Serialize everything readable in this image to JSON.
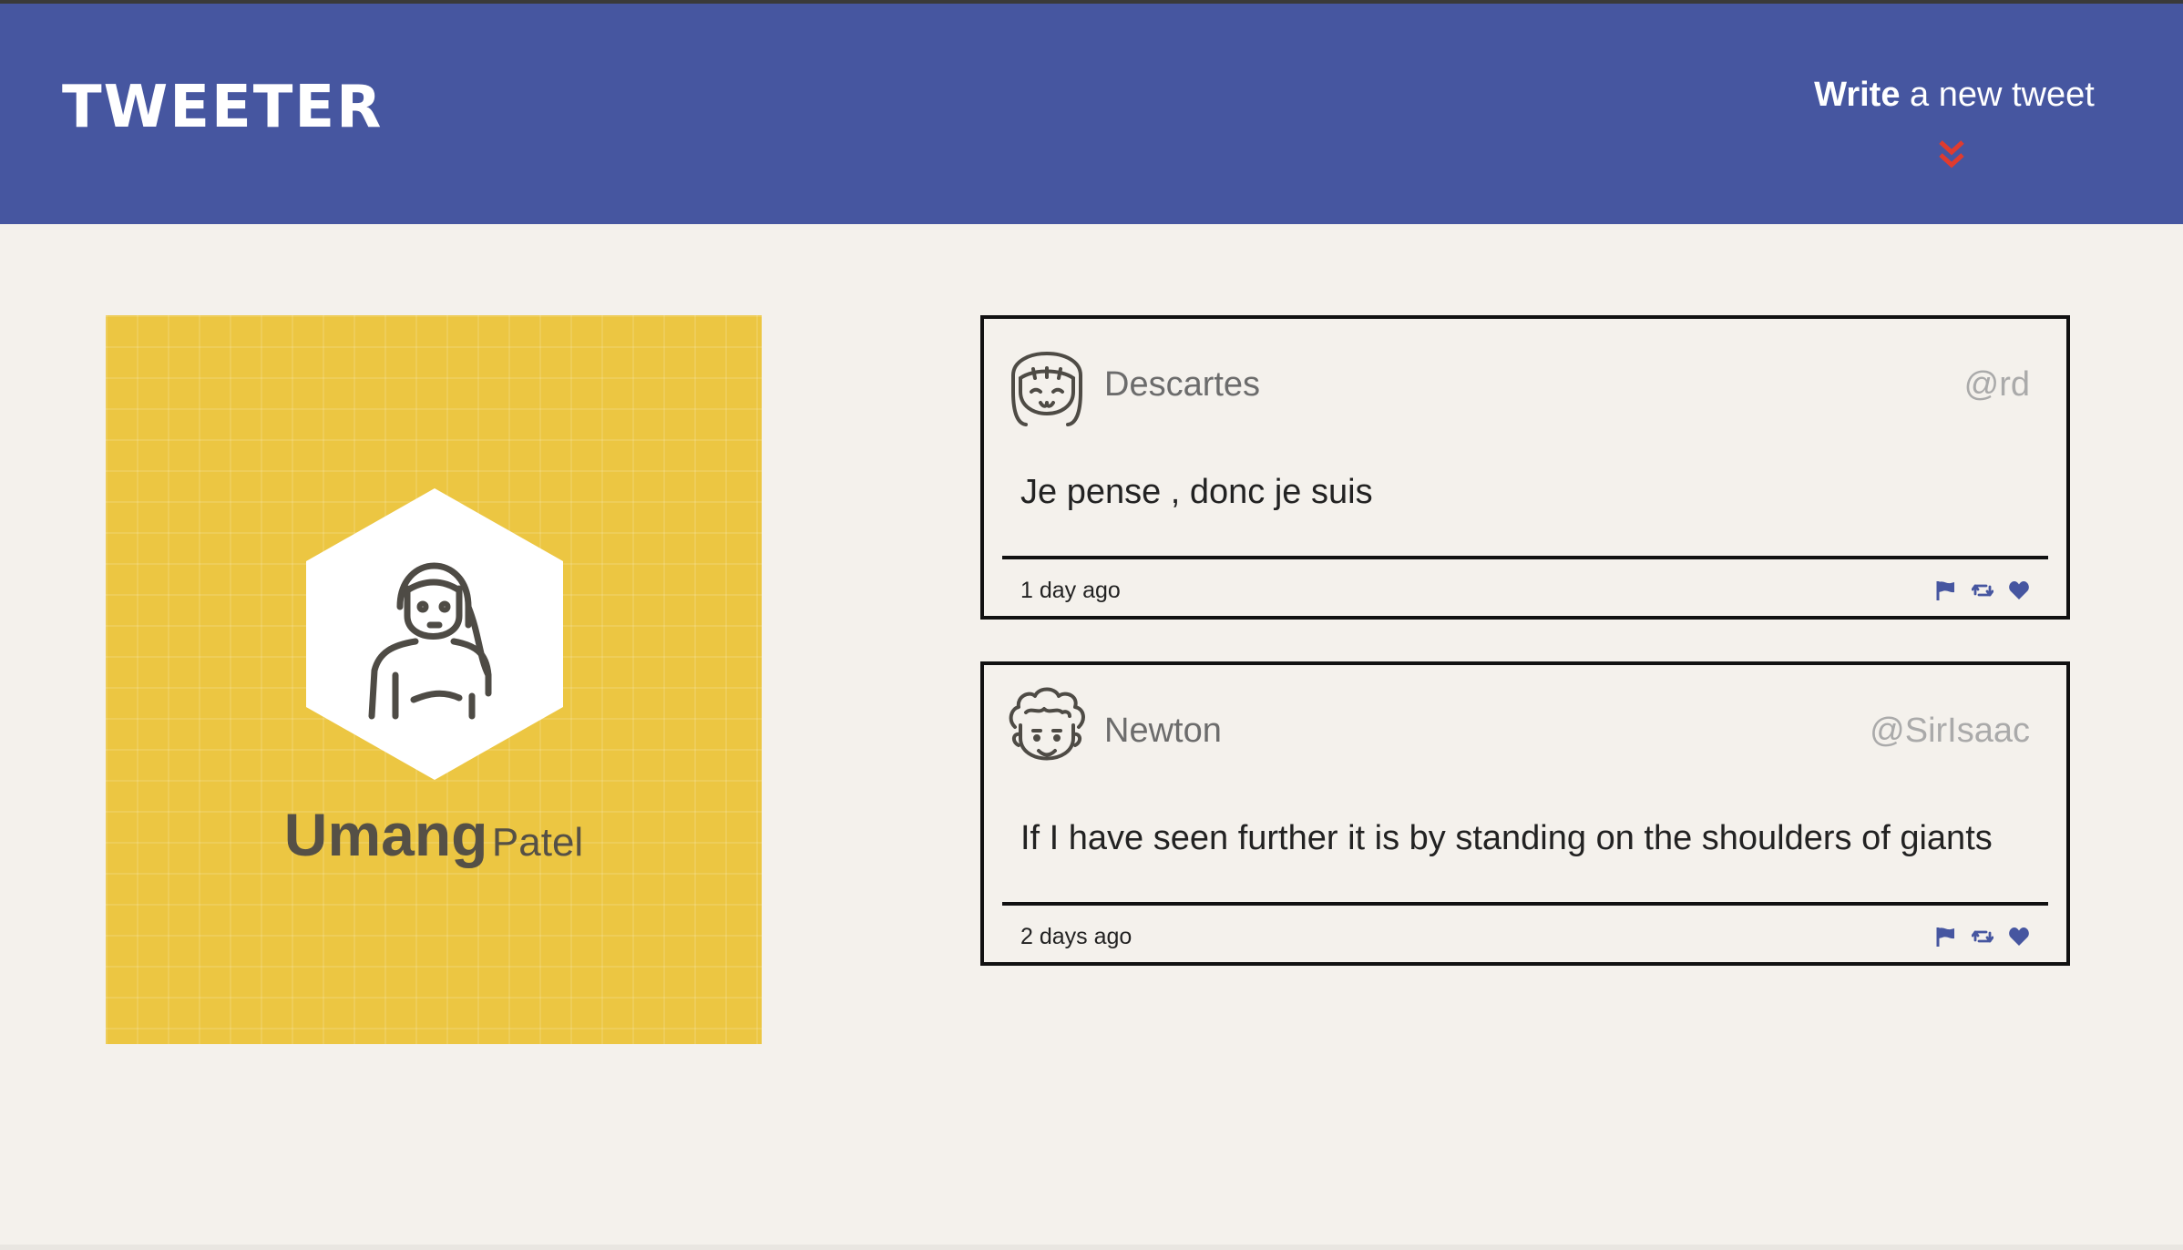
{
  "header": {
    "logo": "TWEETER",
    "compose_bold": "Write",
    "compose_rest": " a new tweet",
    "compose_icon": "double-chevron-down-icon",
    "accent_color": "#e03b2e",
    "bar_color": "#4656a0"
  },
  "profile": {
    "first_name": "Umang",
    "last_name": "Patel",
    "card_color": "#ecc642",
    "avatar_icon": "girl-avatar-icon"
  },
  "tweets": [
    {
      "name": "Descartes",
      "handle": "@rd",
      "content": "Je pense , donc je suis",
      "time": "1 day ago",
      "avatar_icon": "girl-face-icon"
    },
    {
      "name": "Newton",
      "handle": "@SirIsaac",
      "content": "If I have seen further it is by standing on the shoulders of giants",
      "time": "2 days ago",
      "avatar_icon": "curly-hair-face-icon"
    }
  ],
  "actions": {
    "flag_icon": "flag-icon",
    "retweet_icon": "retweet-icon",
    "like_icon": "heart-icon",
    "icon_color": "#4656a0"
  }
}
